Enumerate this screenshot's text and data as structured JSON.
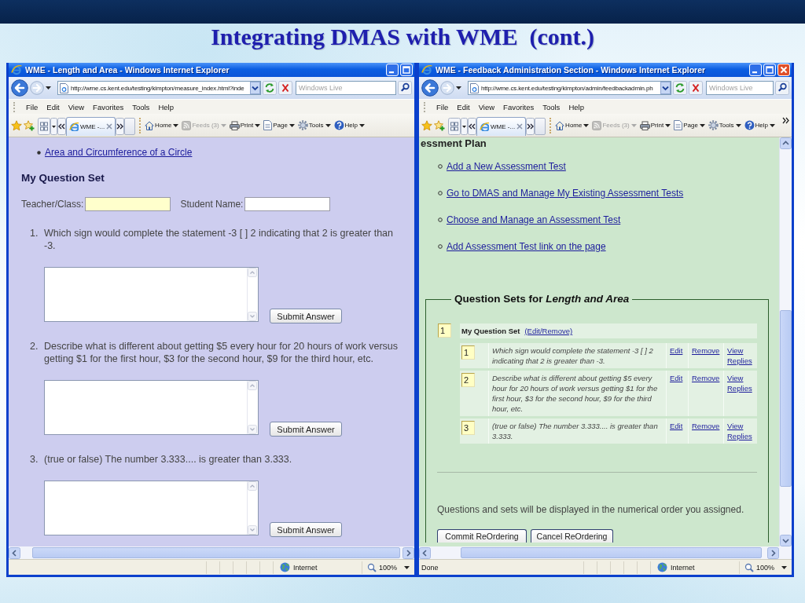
{
  "slide": {
    "title": "Integrating DMAS with WME  (cont.)"
  },
  "windows": [
    {
      "title": "WME - Length and Area - Windows Internet Explorer",
      "title_buttons": [
        {
          "kind": "minimize"
        },
        {
          "kind": "maximize"
        }
      ],
      "address": "http://wme.cs.kent.edu/testing/kimpton/measure_index.html?inde",
      "search": {
        "placeholder": "Windows Live"
      },
      "menu": [
        "File",
        "Edit",
        "View",
        "Favorites",
        "Tools",
        "Help"
      ],
      "tab": {
        "label": "WME -...",
        "selected": true
      },
      "commands": [
        {
          "kind": "home",
          "label": "Home",
          "disabled": false
        },
        {
          "kind": "feeds",
          "label": "Feeds (3)",
          "disabled": true
        },
        {
          "kind": "print",
          "label": "Print",
          "disabled": false
        },
        {
          "kind": "page",
          "label": "Page",
          "disabled": false
        },
        {
          "kind": "tools",
          "label": "Tools",
          "disabled": false
        },
        {
          "kind": "help",
          "label": "Help",
          "disabled": false
        }
      ],
      "more_commands": false,
      "vertical_scrollbar": false,
      "page": {
        "kind": "quiz",
        "links": [
          "Area and Circumference of a Circle"
        ],
        "heading": "My Question Set",
        "fields": [
          {
            "label": "Teacher/Class:",
            "highlighted": true
          },
          {
            "label": "Student Name:",
            "highlighted": false
          }
        ],
        "questions": [
          {
            "number": "1.",
            "text": "Which sign would complete the statement -3 [ ] 2 indicating that 2 is greater than -3.",
            "button": "Submit Answer"
          },
          {
            "number": "2.",
            "text": "Describe what is different about getting $5 every hour for 20 hours of work versus getting $1 for the first hour, $3 for the second hour, $9 for the third hour, etc.",
            "button": "Submit Answer"
          },
          {
            "number": "3.",
            "text": "(true or false) The number 3.333.... is greater than 3.333.",
            "button": "Submit Answer"
          }
        ]
      },
      "status": {
        "zone": "Internet",
        "zoom": "100%"
      }
    },
    {
      "title": "WME - Feedback Administration Section - Windows Internet Explorer",
      "title_buttons": [
        {
          "kind": "minimize"
        },
        {
          "kind": "maximize"
        },
        {
          "kind": "close"
        }
      ],
      "address": "http://wme.cs.kent.edu/testing/kimpton/admin/feedbackadmin.ph",
      "search": {
        "placeholder": "Windows Live"
      },
      "menu": [
        "File",
        "Edit",
        "View",
        "Favorites",
        "Tools",
        "Help"
      ],
      "tab": {
        "label": "WME -...",
        "selected": true
      },
      "commands": [
        {
          "kind": "home",
          "label": "Home",
          "disabled": false
        },
        {
          "kind": "feeds",
          "label": "Feeds (3)",
          "disabled": true
        },
        {
          "kind": "print",
          "label": "Print",
          "disabled": false
        },
        {
          "kind": "page",
          "label": "Page",
          "disabled": false
        },
        {
          "kind": "tools",
          "label": "Tools",
          "disabled": false
        },
        {
          "kind": "help",
          "label": "Help",
          "disabled": false
        }
      ],
      "more_commands": true,
      "vertical_scrollbar": true,
      "page": {
        "kind": "admin",
        "cut_heading": "essment Plan",
        "links": [
          "Add a New Assessment Test",
          "Go to DMAS and Manage My Existing Assessment Tests",
          "Choose and Manage an Assessment Test",
          "Add Assessment Test link on the page"
        ],
        "panel": {
          "legend": "Question Sets for *Length and Area*",
          "sets": [
            {
              "order": "1",
              "name": "My Question Set",
              "link": "(Edit/Remove)",
              "questions": [
                {
                  "order": "1",
                  "text": "Which sign would complete the statement -3 [ ] 2 indicating that 2 is greater than -3.",
                  "actions": [
                    "Edit",
                    "Remove",
                    "View Replies"
                  ]
                },
                {
                  "order": "2",
                  "text": "Describe what is different about getting $5 every hour for 20 hours of work versus getting $1 for the first hour, $3 for the second hour, $9 for the third hour, etc.",
                  "actions": [
                    "Edit",
                    "Remove",
                    "View Replies"
                  ]
                },
                {
                  "order": "3",
                  "text": "(true or false) The number 3.333.... is greater than 3.333.",
                  "actions": [
                    "Edit",
                    "Remove",
                    "View Replies"
                  ]
                }
              ]
            }
          ]
        },
        "note": "Questions and sets will be displayed in the numerical order you assigned.",
        "buttons": [
          "Commit ReOrdering",
          "Cancel ReOrdering"
        ]
      },
      "status": {
        "text": "Done",
        "zone": "Internet",
        "zoom": "100%"
      }
    }
  ]
}
